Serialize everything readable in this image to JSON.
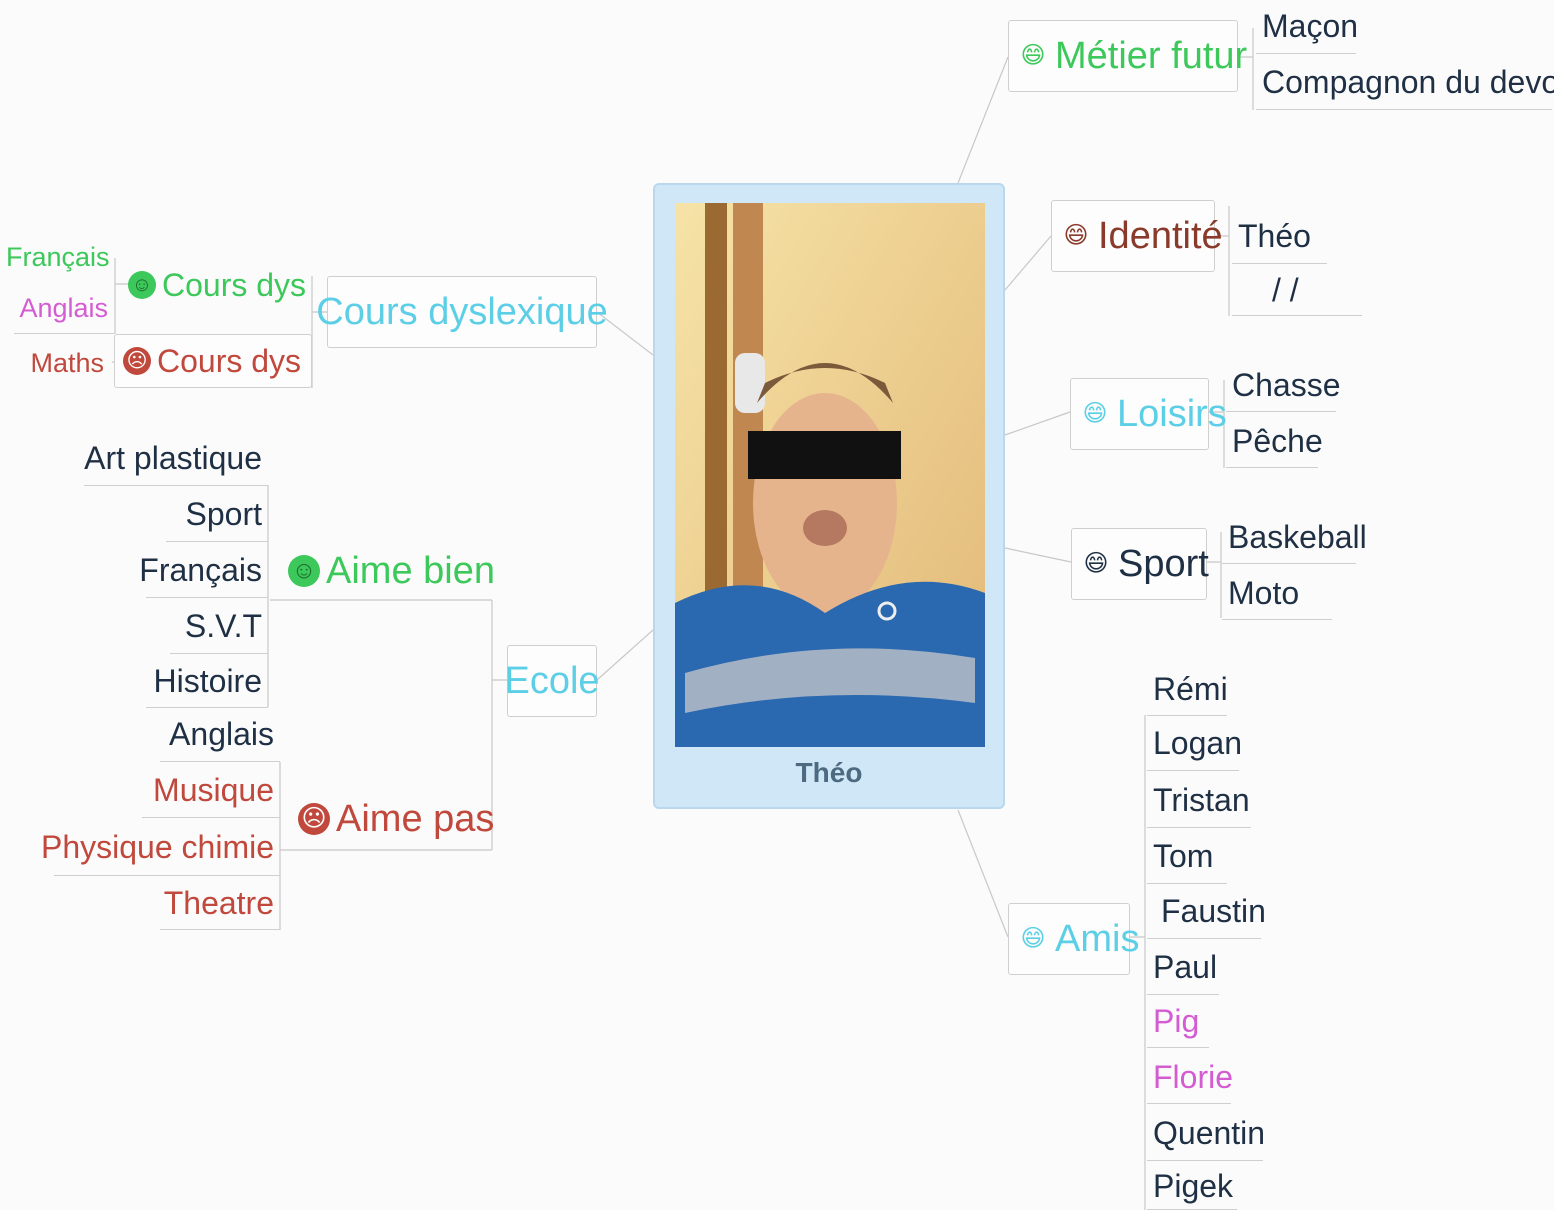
{
  "colors": {
    "green": "#3cc85a",
    "cyan": "#5ccfe6",
    "brown": "#8a3a2a",
    "dark": "#1f3045",
    "red": "#c0483c",
    "pink": "#d45cd2",
    "line": "#c8c8c8"
  },
  "center": {
    "name": "Théo"
  },
  "branches": {
    "metier": {
      "label": "Métier futur",
      "icon": "laughing-face-icon",
      "children": [
        "Maçon",
        "Compagnon du devoir"
      ]
    },
    "identite": {
      "label": "Identité",
      "icon": "laughing-face-icon",
      "children": [
        "Théo",
        "/ /"
      ]
    },
    "loisirs": {
      "label": "Loisirs",
      "icon": "laughing-face-icon",
      "children": [
        "Chasse",
        "Pêche"
      ]
    },
    "sport": {
      "label": "Sport",
      "icon": "laughing-face-icon",
      "children": [
        "Baskeball",
        "Moto"
      ]
    },
    "amis": {
      "label": "Amis",
      "icon": "laughing-face-icon",
      "children": [
        "Rémi",
        "Logan",
        "Tristan",
        "Tom",
        "Faustin",
        "Paul",
        "Pig",
        "Florie",
        "Quentin",
        "Pigek"
      ]
    },
    "cours": {
      "label": "Cours dyslexique",
      "good": {
        "label": "Cours dys",
        "icon": "smiling-face-icon",
        "children": [
          "Français",
          "Anglais"
        ]
      },
      "bad": {
        "label": "Cours dys",
        "icon": "angry-face-icon",
        "children": [
          "Maths"
        ]
      }
    },
    "ecole": {
      "label": "Ecole",
      "likes": {
        "label": "Aime bien",
        "icon": "smiling-face-icon",
        "children": [
          "Art plastique",
          "Sport",
          "Français",
          "S.V.T",
          "Histoire"
        ]
      },
      "dislikes": {
        "label": "Aime pas",
        "icon": "angry-face-icon",
        "children": [
          "Anglais",
          "Musique",
          "Physique chimie",
          "Theatre"
        ]
      }
    }
  }
}
